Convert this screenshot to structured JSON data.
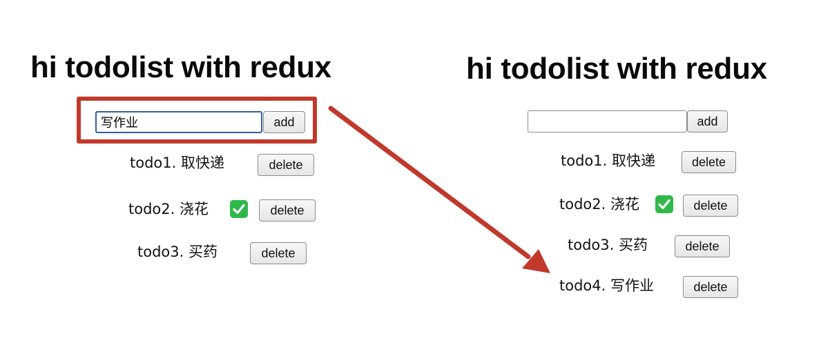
{
  "colors": {
    "annotation": "#c0392b",
    "focus_border": "#2f5ea8",
    "check_green": "#2fb84a"
  },
  "before": {
    "title": "hi todolist with redux",
    "input": {
      "value": "写作业",
      "placeholder": ""
    },
    "add_label": "add",
    "items": [
      {
        "label": "todo1. 取快递",
        "done": false,
        "delete_label": "delete"
      },
      {
        "label": "todo2. 浇花",
        "done": true,
        "delete_label": "delete"
      },
      {
        "label": "todo3. 买药",
        "done": false,
        "delete_label": "delete"
      }
    ]
  },
  "after": {
    "title": "hi todolist with redux",
    "input": {
      "value": "",
      "placeholder": ""
    },
    "add_label": "add",
    "items": [
      {
        "label": "todo1. 取快递",
        "done": false,
        "delete_label": "delete"
      },
      {
        "label": "todo2. 浇花",
        "done": true,
        "delete_label": "delete"
      },
      {
        "label": "todo3. 买药",
        "done": false,
        "delete_label": "delete"
      },
      {
        "label": "todo4. 写作业",
        "done": false,
        "delete_label": "delete"
      }
    ]
  },
  "annotations": {
    "check_icon": "check-mark-icon",
    "arrow_icon": "arrow-right-down-icon"
  }
}
